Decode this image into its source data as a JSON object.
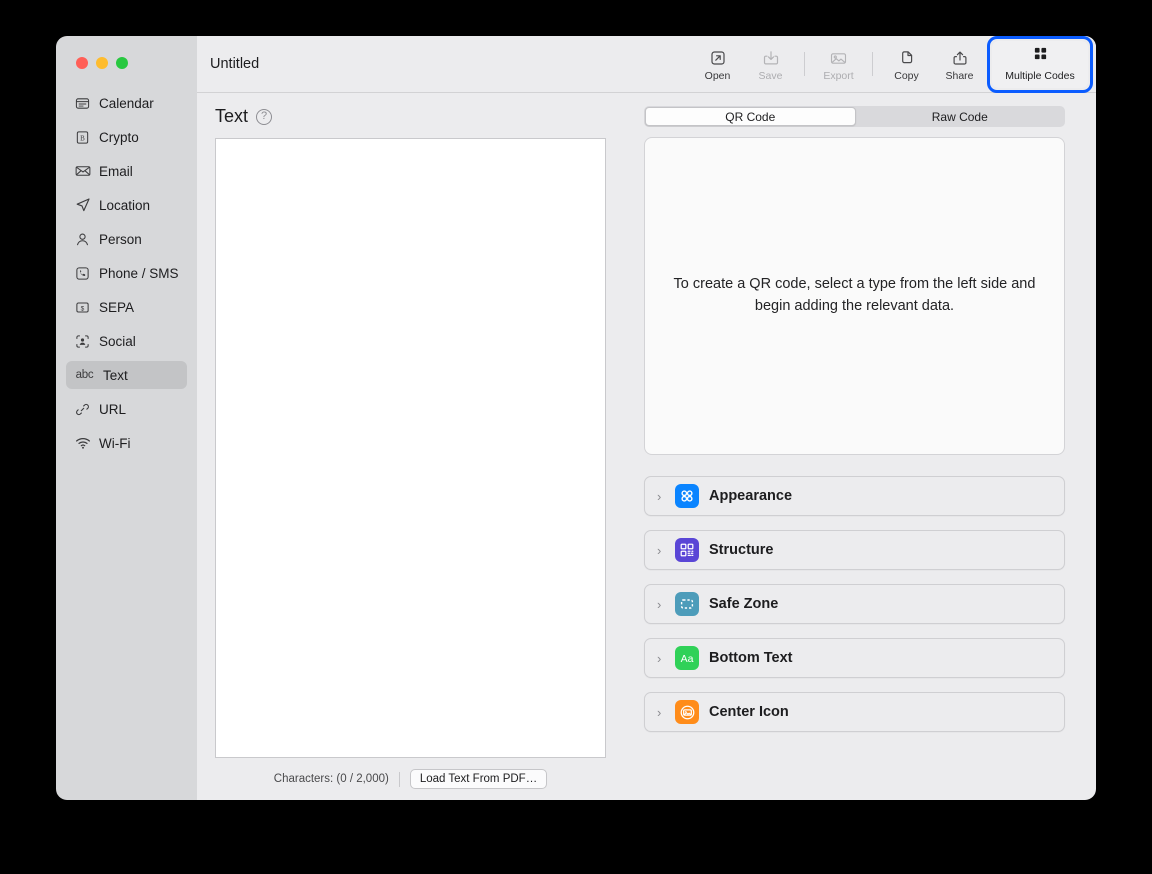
{
  "window": {
    "title": "Untitled",
    "traffic_lights": [
      {
        "name": "close",
        "color": "#ff5f57"
      },
      {
        "name": "minimize",
        "color": "#febc2e"
      },
      {
        "name": "zoom",
        "color": "#28c840"
      }
    ]
  },
  "sidebar": {
    "items": [
      {
        "label": "Calendar",
        "icon": "calendar-icon",
        "selected": false
      },
      {
        "label": "Crypto",
        "icon": "crypto-icon",
        "selected": false
      },
      {
        "label": "Email",
        "icon": "envelope-icon",
        "selected": false
      },
      {
        "label": "Location",
        "icon": "location-arrow-icon",
        "selected": false
      },
      {
        "label": "Person",
        "icon": "person-icon",
        "selected": false
      },
      {
        "label": "Phone / SMS",
        "icon": "phone-icon",
        "selected": false
      },
      {
        "label": "SEPA",
        "icon": "banknote-icon",
        "selected": false
      },
      {
        "label": "Social",
        "icon": "social-icon",
        "selected": false
      },
      {
        "label": "Text",
        "icon": "abc-icon",
        "selected": true
      },
      {
        "label": "URL",
        "icon": "link-icon",
        "selected": false
      },
      {
        "label": "Wi-Fi",
        "icon": "wifi-icon",
        "selected": false
      }
    ]
  },
  "toolbar": {
    "buttons": [
      {
        "label": "Open",
        "icon": "open-icon",
        "disabled": false
      },
      {
        "label": "Save",
        "icon": "save-icon",
        "disabled": true
      },
      {
        "label": "Export",
        "icon": "export-image-icon",
        "disabled": true
      },
      {
        "label": "Copy",
        "icon": "copy-icon",
        "disabled": false
      },
      {
        "label": "Share",
        "icon": "share-icon",
        "disabled": false
      }
    ],
    "multiple_codes": {
      "label": "Multiple Codes",
      "icon": "grid-squares-icon"
    },
    "highlight_color": "#0b5cff"
  },
  "editor": {
    "title": "Text",
    "help_glyph": "?",
    "text_value": "",
    "char_count": "Characters: (0 / 2,000)",
    "load_pdf_label": "Load Text From PDF…"
  },
  "preview": {
    "tabs": [
      {
        "label": "QR Code",
        "active": true
      },
      {
        "label": "Raw Code",
        "active": false
      }
    ],
    "empty_message": "To create a QR code, select a type from the left side and begin adding the relevant data."
  },
  "sections": [
    {
      "label": "Appearance",
      "icon": "appearance-icon",
      "color": "#0a84ff"
    },
    {
      "label": "Structure",
      "icon": "structure-qr-icon",
      "color": "#5a46d6"
    },
    {
      "label": "Safe Zone",
      "icon": "safe-zone-icon",
      "color": "#4d9cba"
    },
    {
      "label": "Bottom Text",
      "icon": "bottom-text-icon",
      "color": "#30d158"
    },
    {
      "label": "Center Icon",
      "icon": "center-icon-icon",
      "color": "#ff8c1a"
    }
  ]
}
